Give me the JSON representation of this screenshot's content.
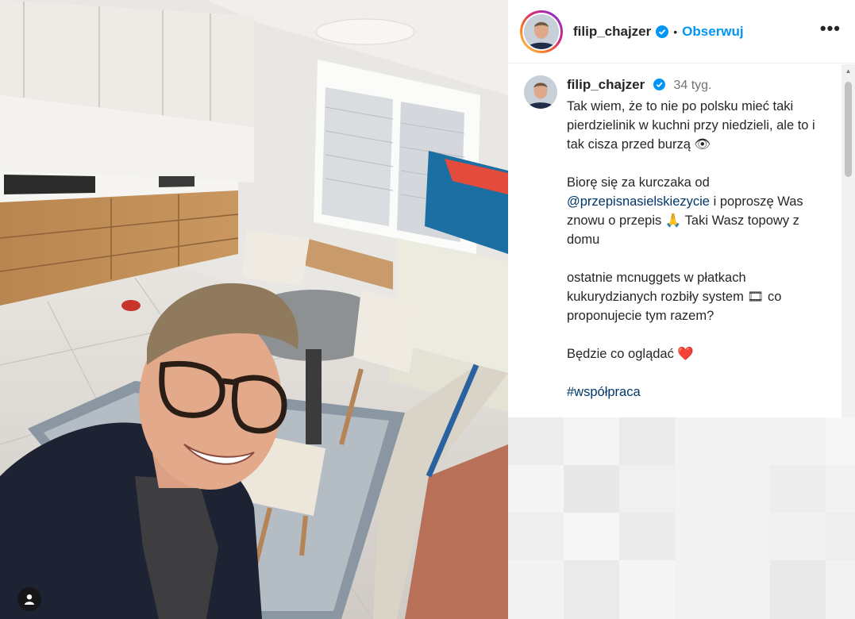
{
  "post": {
    "username": "filip_chajzer",
    "follow_label": "Obserwuj",
    "separator": "•",
    "more_label": "•••",
    "time_ago": "34 tyg.",
    "caption": {
      "p1": "Tak wiem, że to nie po polsku mieć taki pierdzielinik w kuchni przy niedzieli, ale to i tak cisza przed burzą 👁",
      "p2_before": "Biorę się za kurczaka od ",
      "p2_mention": "@przepisnasielskiezycie",
      "p2_after": " i poproszę Was znowu o przepis 🙏 Taki Wasz topowy z domu",
      "p3": "ostatnie mcnuggets w płatkach kukurydzianych rozbiły system 🎞 co proponujecie tym razem?",
      "p4": "Będzie co oglądać ❤️",
      "hashtag": "#współpraca"
    }
  },
  "colors": {
    "follow_blue": "#0095f6",
    "link_dark_blue": "#00376b",
    "verified_blue": "#0095f6",
    "time_gray": "#737373"
  },
  "icons": {
    "verified": "verified-badge-icon",
    "more": "more-options-icon",
    "user_tag": "user-tag-icon"
  }
}
